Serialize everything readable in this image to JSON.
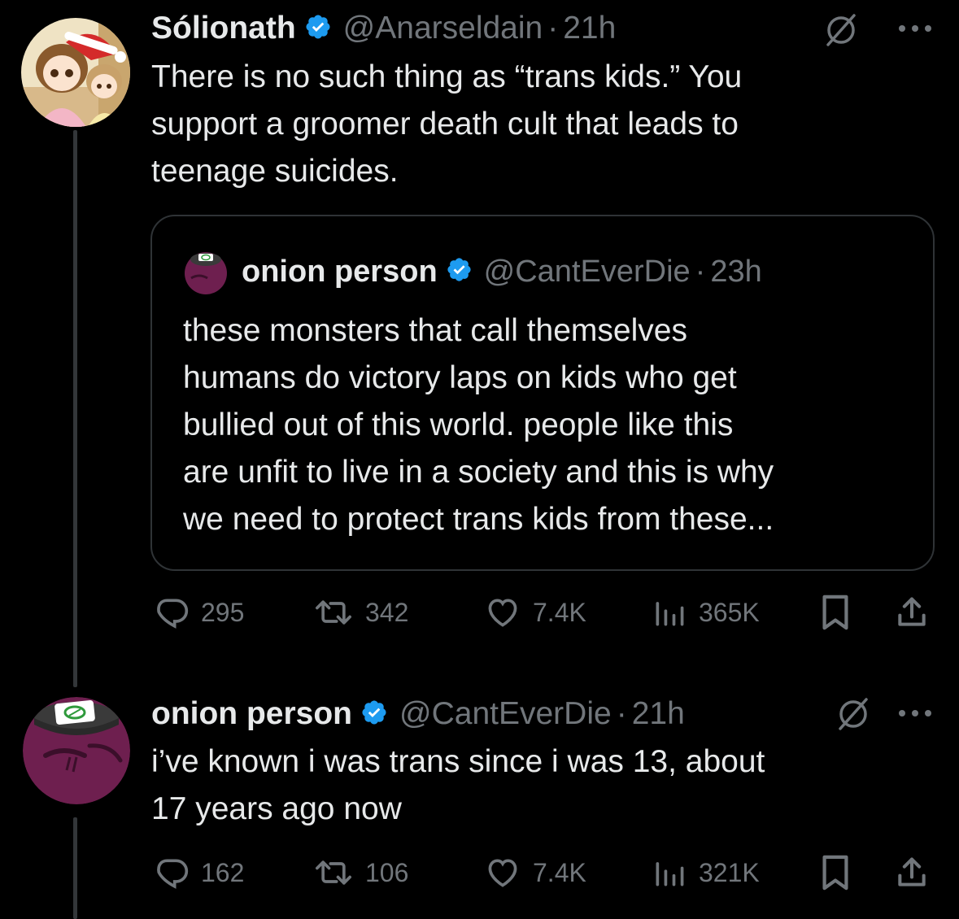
{
  "tweet1": {
    "display_name": "Sólionath",
    "handle": "@Anarseldain",
    "dot": "·",
    "time": "21h",
    "text": "There is no such thing as “trans kids.” You\nsupport a groomer death cult that leads to\nteenage suicides.",
    "quote": {
      "display_name": "onion person",
      "handle": "@CantEverDie",
      "dot": "·",
      "time": "23h",
      "text": "these monsters that call themselves\nhumans do victory laps on kids who get\nbullied out of this world.  people like this\nare unfit to live in a society and this is why\nwe need to protect trans kids from these..."
    },
    "actions": {
      "replies": "295",
      "reposts": "342",
      "likes": "7.4K",
      "views": "365K"
    }
  },
  "tweet2": {
    "display_name": "onion person",
    "handle": "@CantEverDie",
    "dot": "·",
    "time": "21h",
    "text": "i’ve known i was trans since i was 13, about\n17 years ago now",
    "actions": {
      "replies": "162",
      "reposts": "106",
      "likes": "7.4K",
      "views": "321K"
    }
  },
  "colors": {
    "background": "#000000",
    "text": "#e7e9ea",
    "secondary": "#71767b",
    "verified": "#1d9bf0",
    "border": "#2f3336",
    "onion": "#6e1f4f"
  },
  "icons": [
    "reply-icon",
    "repost-icon",
    "like-icon",
    "views-icon",
    "bookmark-icon",
    "share-icon",
    "grok-icon",
    "more-icon",
    "verified-badge-icon"
  ]
}
